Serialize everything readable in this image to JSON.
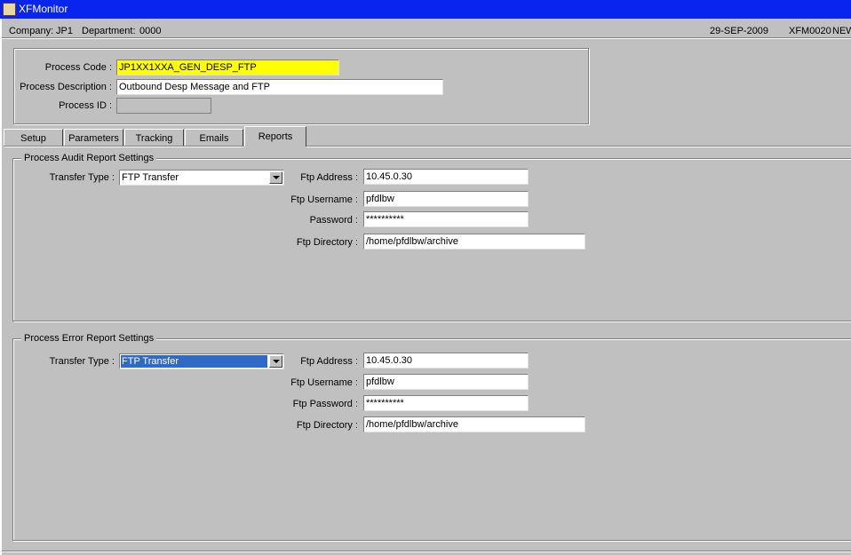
{
  "window": {
    "title": "XFMonitor"
  },
  "infobar": {
    "company_label": "Company:",
    "company_value": "JP1",
    "department_label": "Department:",
    "department_value": "0000",
    "date": "29-SEP-2009",
    "form_code": "XFM0020",
    "truncated_text": "NEW"
  },
  "header": {
    "process_code_label": "Process Code :",
    "process_code_value": "JP1XX1XXA_GEN_DESP_FTP",
    "process_description_label": "Process Description :",
    "process_description_value": "Outbound Desp Message and FTP",
    "process_id_label": "Process ID :",
    "process_id_value": ""
  },
  "tabs": [
    {
      "label": "Setup",
      "active": false
    },
    {
      "label": "Parameters",
      "active": false
    },
    {
      "label": "Tracking",
      "active": false
    },
    {
      "label": "Emails",
      "active": false
    },
    {
      "label": "Reports",
      "active": true
    }
  ],
  "audit": {
    "title": "Process Audit Report Settings",
    "transfer_type_label": "Transfer Type :",
    "transfer_type_value": "FTP Transfer",
    "ftp_address_label": "Ftp Address :",
    "ftp_address_value": "10.45.0.30",
    "ftp_username_label": "Ftp Username :",
    "ftp_username_value": "pfdlbw",
    "password_label": "Password :",
    "password_value": "**********",
    "ftp_directory_label": "Ftp Directory :",
    "ftp_directory_value": "/home/pfdlbw/archive"
  },
  "error": {
    "title": "Process Error Report Settings",
    "transfer_type_label": "Transfer Type :",
    "transfer_type_value": "FTP Transfer",
    "ftp_address_label": "Ftp Address :",
    "ftp_address_value": "10.45.0.30",
    "ftp_username_label": "Ftp Username :",
    "ftp_username_value": "pfdlbw",
    "password_label": "Ftp Password :",
    "password_value": "**********",
    "ftp_directory_label": "Ftp Directory :",
    "ftp_directory_value": "/home/pfdlbw/archive"
  },
  "colors": {
    "titlebar": "#0a24f0",
    "highlight_field": "#ffff00",
    "selection": "#316ac5"
  },
  "icons": {
    "app": "xfmonitor-app-icon",
    "dropdown": "chevron-down-icon"
  }
}
